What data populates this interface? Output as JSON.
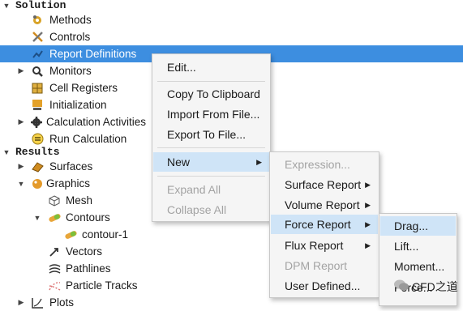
{
  "tree": {
    "solution_label": "Solution",
    "methods": "Methods",
    "controls": "Controls",
    "report_definitions": "Report Definitions",
    "monitors": "Monitors",
    "cell_registers": "Cell Registers",
    "initialization": "Initialization",
    "calculation_activities": "Calculation Activities",
    "run_calculation": "Run Calculation",
    "results_label": "Results",
    "surfaces": "Surfaces",
    "graphics": "Graphics",
    "mesh": "Mesh",
    "contours": "Contours",
    "contour_1": "contour-1",
    "vectors": "Vectors",
    "pathlines": "Pathlines",
    "particle_tracks": "Particle Tracks",
    "plots": "Plots"
  },
  "context_menu": {
    "edit": "Edit...",
    "copy_to_clipboard": "Copy To Clipboard",
    "import_from_file": "Import From File...",
    "export_to_file": "Export To File...",
    "new": "New",
    "expand_all": "Expand All",
    "collapse_all": "Collapse All"
  },
  "new_submenu": {
    "expression": "Expression...",
    "surface_report": "Surface Report",
    "volume_report": "Volume Report",
    "force_report": "Force Report",
    "flux_report": "Flux Report",
    "dpm_report": "DPM Report",
    "user_defined": "User Defined..."
  },
  "force_submenu": {
    "drag": "Drag...",
    "lift": "Lift...",
    "moment": "Moment...",
    "force": "Force..."
  },
  "watermark": {
    "text": "CFD之道"
  },
  "colors": {
    "selection": "#3d8ee0",
    "menu_hover": "#cfe4f7",
    "disabled_text": "#a3a3a3"
  }
}
